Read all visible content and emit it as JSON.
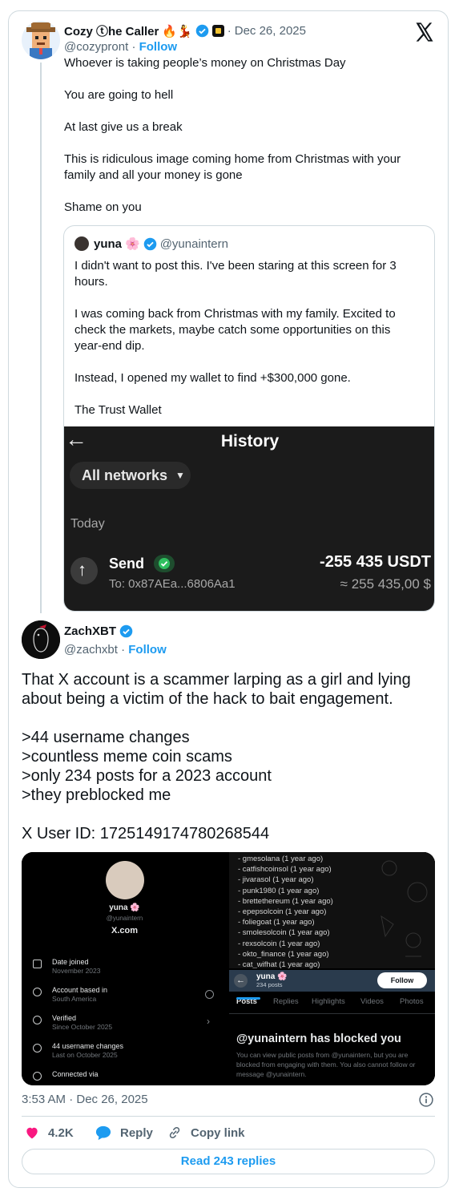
{
  "tweet": {
    "author_name": "Cozy ⓣhe Caller",
    "author_emojis": "🔥💃",
    "date_sep": "·",
    "date": "Dec 26, 2025",
    "handle": "@cozypront",
    "follow_label": "Follow",
    "paragraphs": [
      "Whoever is taking people’s money on Christmas Day",
      "You are going to hell",
      "At last give us a break",
      "This is ridiculous image coming home from Christmas with your family and all your money is gone",
      "Shame on you"
    ]
  },
  "quote": {
    "author_name": "yuna",
    "flower": "🌸",
    "handle": "@yunaintern",
    "paragraphs": [
      "I didn't want to post this. I've been staring at this screen for 3 hours.",
      "I was coming back from Christmas with my family. Excited to check the markets, maybe catch some opportunities on this year-end dip.",
      "Instead, I opened my wallet to find +$300,000 gone.",
      "The Trust Wallet"
    ],
    "wallet": {
      "back_arrow": "←",
      "title": "History",
      "network_filter": "All networks",
      "filter_caret": "▼",
      "section": "Today",
      "tx_type": "Send",
      "tx_arrow": "↑",
      "tx_to": "To: 0x87AEa...6806Aa1",
      "tx_amount": "-255 435 USDT",
      "tx_fiat": "≈ 255 435,00 $"
    }
  },
  "reply": {
    "author_name": "ZachXBT",
    "handle": "@zachxbt",
    "follow_label": "Follow",
    "paragraph1": "That X account is a scammer larping as a girl and lying about being a victim of the hack to bait engagement.",
    "greentext": [
      ">44 username changes",
      ">countless meme coin scams",
      ">only 234 posts for a 2023 account",
      ">they preblocked me"
    ],
    "user_id": "X User ID: 1725149174780268544"
  },
  "media": {
    "profile": {
      "name": "yuna 🌸",
      "handle": "@yunaintern",
      "site": "X.com",
      "rows": [
        {
          "title": "Date joined",
          "sub": "November 2023"
        },
        {
          "title": "Account based in",
          "sub": "South America"
        },
        {
          "title": "Verified",
          "sub": "Since October 2025"
        },
        {
          "title": "44 username changes",
          "sub": "Last on October 2025"
        },
        {
          "title": "Connected via",
          "sub": ""
        }
      ]
    },
    "username_history": [
      "- gmesolana (1 year ago)",
      "- catfishcoinsol (1 year ago)",
      "- jivarasol (1 year ago)",
      "- punk1980 (1 year ago)",
      "- brettethereum (1 year ago)",
      "- epepsolcoin (1 year ago)",
      "- foliegoat (1 year ago)",
      "- smolesolcoin (1 year ago)",
      "- rexsolcoin (1 year ago)",
      "- okto_finance (1 year ago)",
      "- cat_wifhat (1 year ago)"
    ],
    "blocked": {
      "back": "←",
      "name": "yuna 🌸",
      "posts": "234 posts",
      "follow": "Follow",
      "tabs": [
        "Posts",
        "Replies",
        "Highlights",
        "Videos",
        "Photos"
      ],
      "headline": "@yunaintern has blocked you",
      "description": "You can view public posts from @yunaintern, but you are blocked from engaging with them. You also cannot follow or message @yunaintern."
    }
  },
  "footer": {
    "timestamp": "3:53 AM · Dec 26, 2025",
    "likes": "4.2K",
    "reply_label": "Reply",
    "copy_link_label": "Copy link",
    "read_replies": "Read 243 replies"
  },
  "colors": {
    "accent": "#1d9bf0",
    "like": "#f91880",
    "wallet_bg": "#1b1b1b"
  },
  "icons": [
    "x-logo-icon",
    "verified-badge-icon",
    "heart-icon",
    "reply-bubble-icon",
    "link-icon",
    "info-icon"
  ]
}
